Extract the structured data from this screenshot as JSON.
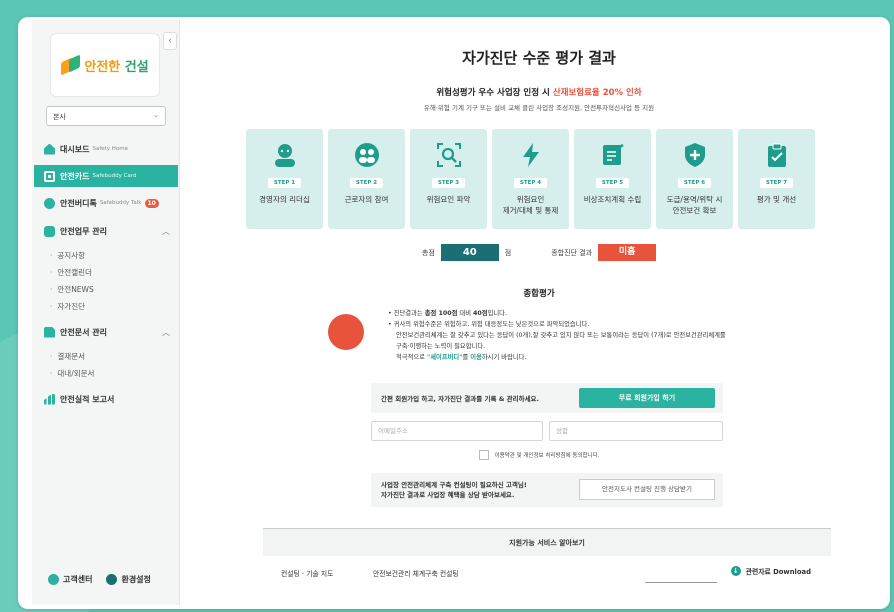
{
  "brand": {
    "logo_part1": "안전한",
    "logo_part2": "건설"
  },
  "branch_select": {
    "value": "본사"
  },
  "nav": {
    "dashboard": {
      "label": "대시보드",
      "sub": "Safety Home"
    },
    "card": {
      "label": "안전카드",
      "sub": "Safebuddy Card"
    },
    "talk": {
      "label": "안전버디톡",
      "sub": "Safebuddy Talk",
      "badge": "10"
    },
    "work": {
      "label": "안전업무 관리",
      "toggle": "︿",
      "items": [
        "공지사항",
        "안전캘린더",
        "안전NEWS",
        "자가진단"
      ]
    },
    "docs": {
      "label": "안전문서 관리",
      "toggle": "︿",
      "items": [
        "결재문서",
        "대내/외문서"
      ]
    },
    "report": {
      "label": "안전실적 보고서"
    }
  },
  "footer": {
    "support": "고객센터",
    "settings": "환경설정"
  },
  "collapse": "‹",
  "page": {
    "title": "자가진단 수준 평가 결과",
    "sub_prefix": "위험성평가 우수 사업장 인정 시 ",
    "sub_highlight": "산재보험료율 20% 인하",
    "subtext": "유해·위험 기계 기구 또는 설비 교체 클린 사업장 조성지원, 안전투자혁신사업 등 지원"
  },
  "steps": [
    {
      "tag": "STEP 1",
      "label1": "경영자의 리더십",
      "label2": "",
      "icon": "leader-icon"
    },
    {
      "tag": "STEP 2",
      "label1": "근로자의 참여",
      "label2": "",
      "icon": "workers-icon"
    },
    {
      "tag": "STEP 3",
      "label1": "위험요인 파악",
      "label2": "",
      "icon": "magnifier-icon"
    },
    {
      "tag": "STEP 4",
      "label1": "위험요인",
      "label2": "제거/대체 및 통제",
      "icon": "lightning-icon"
    },
    {
      "tag": "STEP 5",
      "label1": "비상조치계획 수립",
      "label2": "",
      "icon": "document-icon"
    },
    {
      "tag": "STEP 6",
      "label1": "도급/용역/위탁 시",
      "label2": "안전보건 확보",
      "icon": "shield-icon"
    },
    {
      "tag": "STEP 7",
      "label1": "평가 및 개선",
      "label2": "",
      "icon": "clipboard-icon"
    }
  ],
  "score": {
    "label": "총점",
    "value": "40",
    "unit": "점",
    "result_label": "종합진단 결과",
    "result": "미흡"
  },
  "summary": {
    "title": "종합평가",
    "l1_pre": "• 진단결과는 ",
    "l1_b1": "총점 100점",
    "l1_mid": " 대비 ",
    "l1_b2": "40점",
    "l1_post": "입니다.",
    "l2": "• 귀사의 위험수준은 위험하고, 위험 대응정도는 낮은것으로 파악되었습니다.",
    "l3": "안전보건관리체계는 잘 갖추고 있다는 응답이 (0개),잘 갖추고 있지 않다 또는 보통이라는 응답이 (7개)로 안전보건관리체계를",
    "l4": "구축·이행하는 노력이 필요합니다.",
    "l5_pre": "적극적으로 ",
    "l5_hl1": "\"세이프버디\"",
    "l5_mid": "를 ",
    "l5_hl2": "이용",
    "l5_post": "하시기 바랍니다."
  },
  "signup": {
    "text": "간편 회원가입 하고, 자가진단 결과를 기록 & 관리하세요.",
    "button": "무료 회원가입 하기"
  },
  "fields": {
    "email": "이메일주소",
    "name": "성함"
  },
  "agree": "이용약관 및 개인정보 처리방침에 동의합니다.",
  "consult": {
    "line1": "사업장 안전관리체계 구축 컨설팅이 필요하신 고객님!",
    "line2": "자가진단 결과로 사업장 혜택을 상담 받아보세요.",
    "button": "안전지도사 컨설팅 진행 상담받기"
  },
  "services": {
    "title": "지원가능 서비스 알아보기",
    "row": {
      "category": "컨설팅 · 기술 지도",
      "name": "안전보건관리 체계구축 컨설팅",
      "download": "관련자료 Download"
    }
  },
  "colors": {
    "accent": "#2ab3a0",
    "danger": "#e8533c",
    "score_bg": "#1b6e73",
    "step_bg": "#d6efec"
  }
}
